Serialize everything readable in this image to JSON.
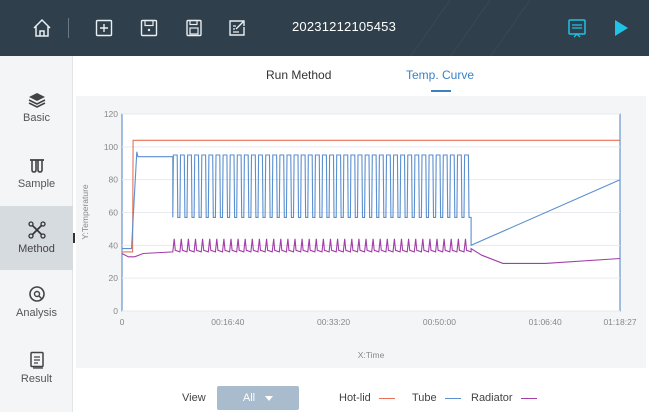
{
  "app": {
    "run_id": "20231212105453",
    "toolbar_icons": [
      "home-icon",
      "new-file-icon",
      "load-file-icon",
      "save-icon",
      "export-icon",
      "monitor-icon",
      "play-icon"
    ]
  },
  "sidebar": {
    "items": [
      {
        "label": "Basic",
        "icon": "layers-icon",
        "active": false
      },
      {
        "label": "Sample",
        "icon": "tubes-icon",
        "active": false
      },
      {
        "label": "Method",
        "icon": "method-icon",
        "active": true
      },
      {
        "label": "Analysis",
        "icon": "analysis-icon",
        "active": false
      },
      {
        "label": "Result",
        "icon": "result-icon",
        "active": false
      }
    ]
  },
  "tabs": [
    {
      "label": "Run Method",
      "active": false
    },
    {
      "label": "Temp. Curve",
      "active": true
    }
  ],
  "footer": {
    "view_label": "View",
    "view_value": "All"
  },
  "colors": {
    "topbar": "#2f3f4b",
    "accent": "#3b82c4",
    "play": "#1fc3e6",
    "hot_lid": "#e8715a",
    "tube": "#5b8fd0",
    "radiator": "#a13ea8"
  },
  "chart_data": {
    "type": "line",
    "xlabel": "X:Time",
    "ylabel": "Y:Temperature",
    "ylim": [
      0,
      120
    ],
    "xlim": [
      0,
      4707
    ],
    "y_ticks": [
      0,
      20,
      40,
      60,
      80,
      100,
      120
    ],
    "x_ticks": [
      {
        "t": 0,
        "label": "0"
      },
      {
        "t": 1000,
        "label": "00:16:40"
      },
      {
        "t": 2000,
        "label": "00:33:20"
      },
      {
        "t": 3000,
        "label": "00:50:00"
      },
      {
        "t": 4000,
        "label": "01:06:40"
      },
      {
        "t": 4707,
        "label": "01:18:27"
      }
    ],
    "series": [
      {
        "name": "Hot-lid",
        "color": "#e8715a",
        "points": [
          [
            0,
            36
          ],
          [
            100,
            36
          ],
          [
            105,
            104
          ],
          [
            4707,
            104
          ]
        ]
      },
      {
        "name": "Tube",
        "color": "#5b8fd0",
        "cycle": {
          "start": 480,
          "end": 3300,
          "count": 42,
          "high": 95,
          "low": 57
        },
        "points": [
          [
            0,
            38
          ],
          [
            90,
            38
          ],
          [
            140,
            97
          ],
          [
            150,
            94
          ],
          [
            480,
            94
          ],
          [
            3300,
            40
          ],
          [
            4707,
            80
          ]
        ]
      },
      {
        "name": "Radiator",
        "color": "#a13ea8",
        "cycle": {
          "start": 480,
          "end": 3300,
          "count": 42,
          "high": 44,
          "low": 36
        },
        "points": [
          [
            0,
            35
          ],
          [
            60,
            33
          ],
          [
            120,
            33
          ],
          [
            200,
            35
          ],
          [
            480,
            36
          ],
          [
            3300,
            38
          ],
          [
            3400,
            34
          ],
          [
            3600,
            29
          ],
          [
            4000,
            29
          ],
          [
            4707,
            32
          ]
        ]
      }
    ]
  }
}
